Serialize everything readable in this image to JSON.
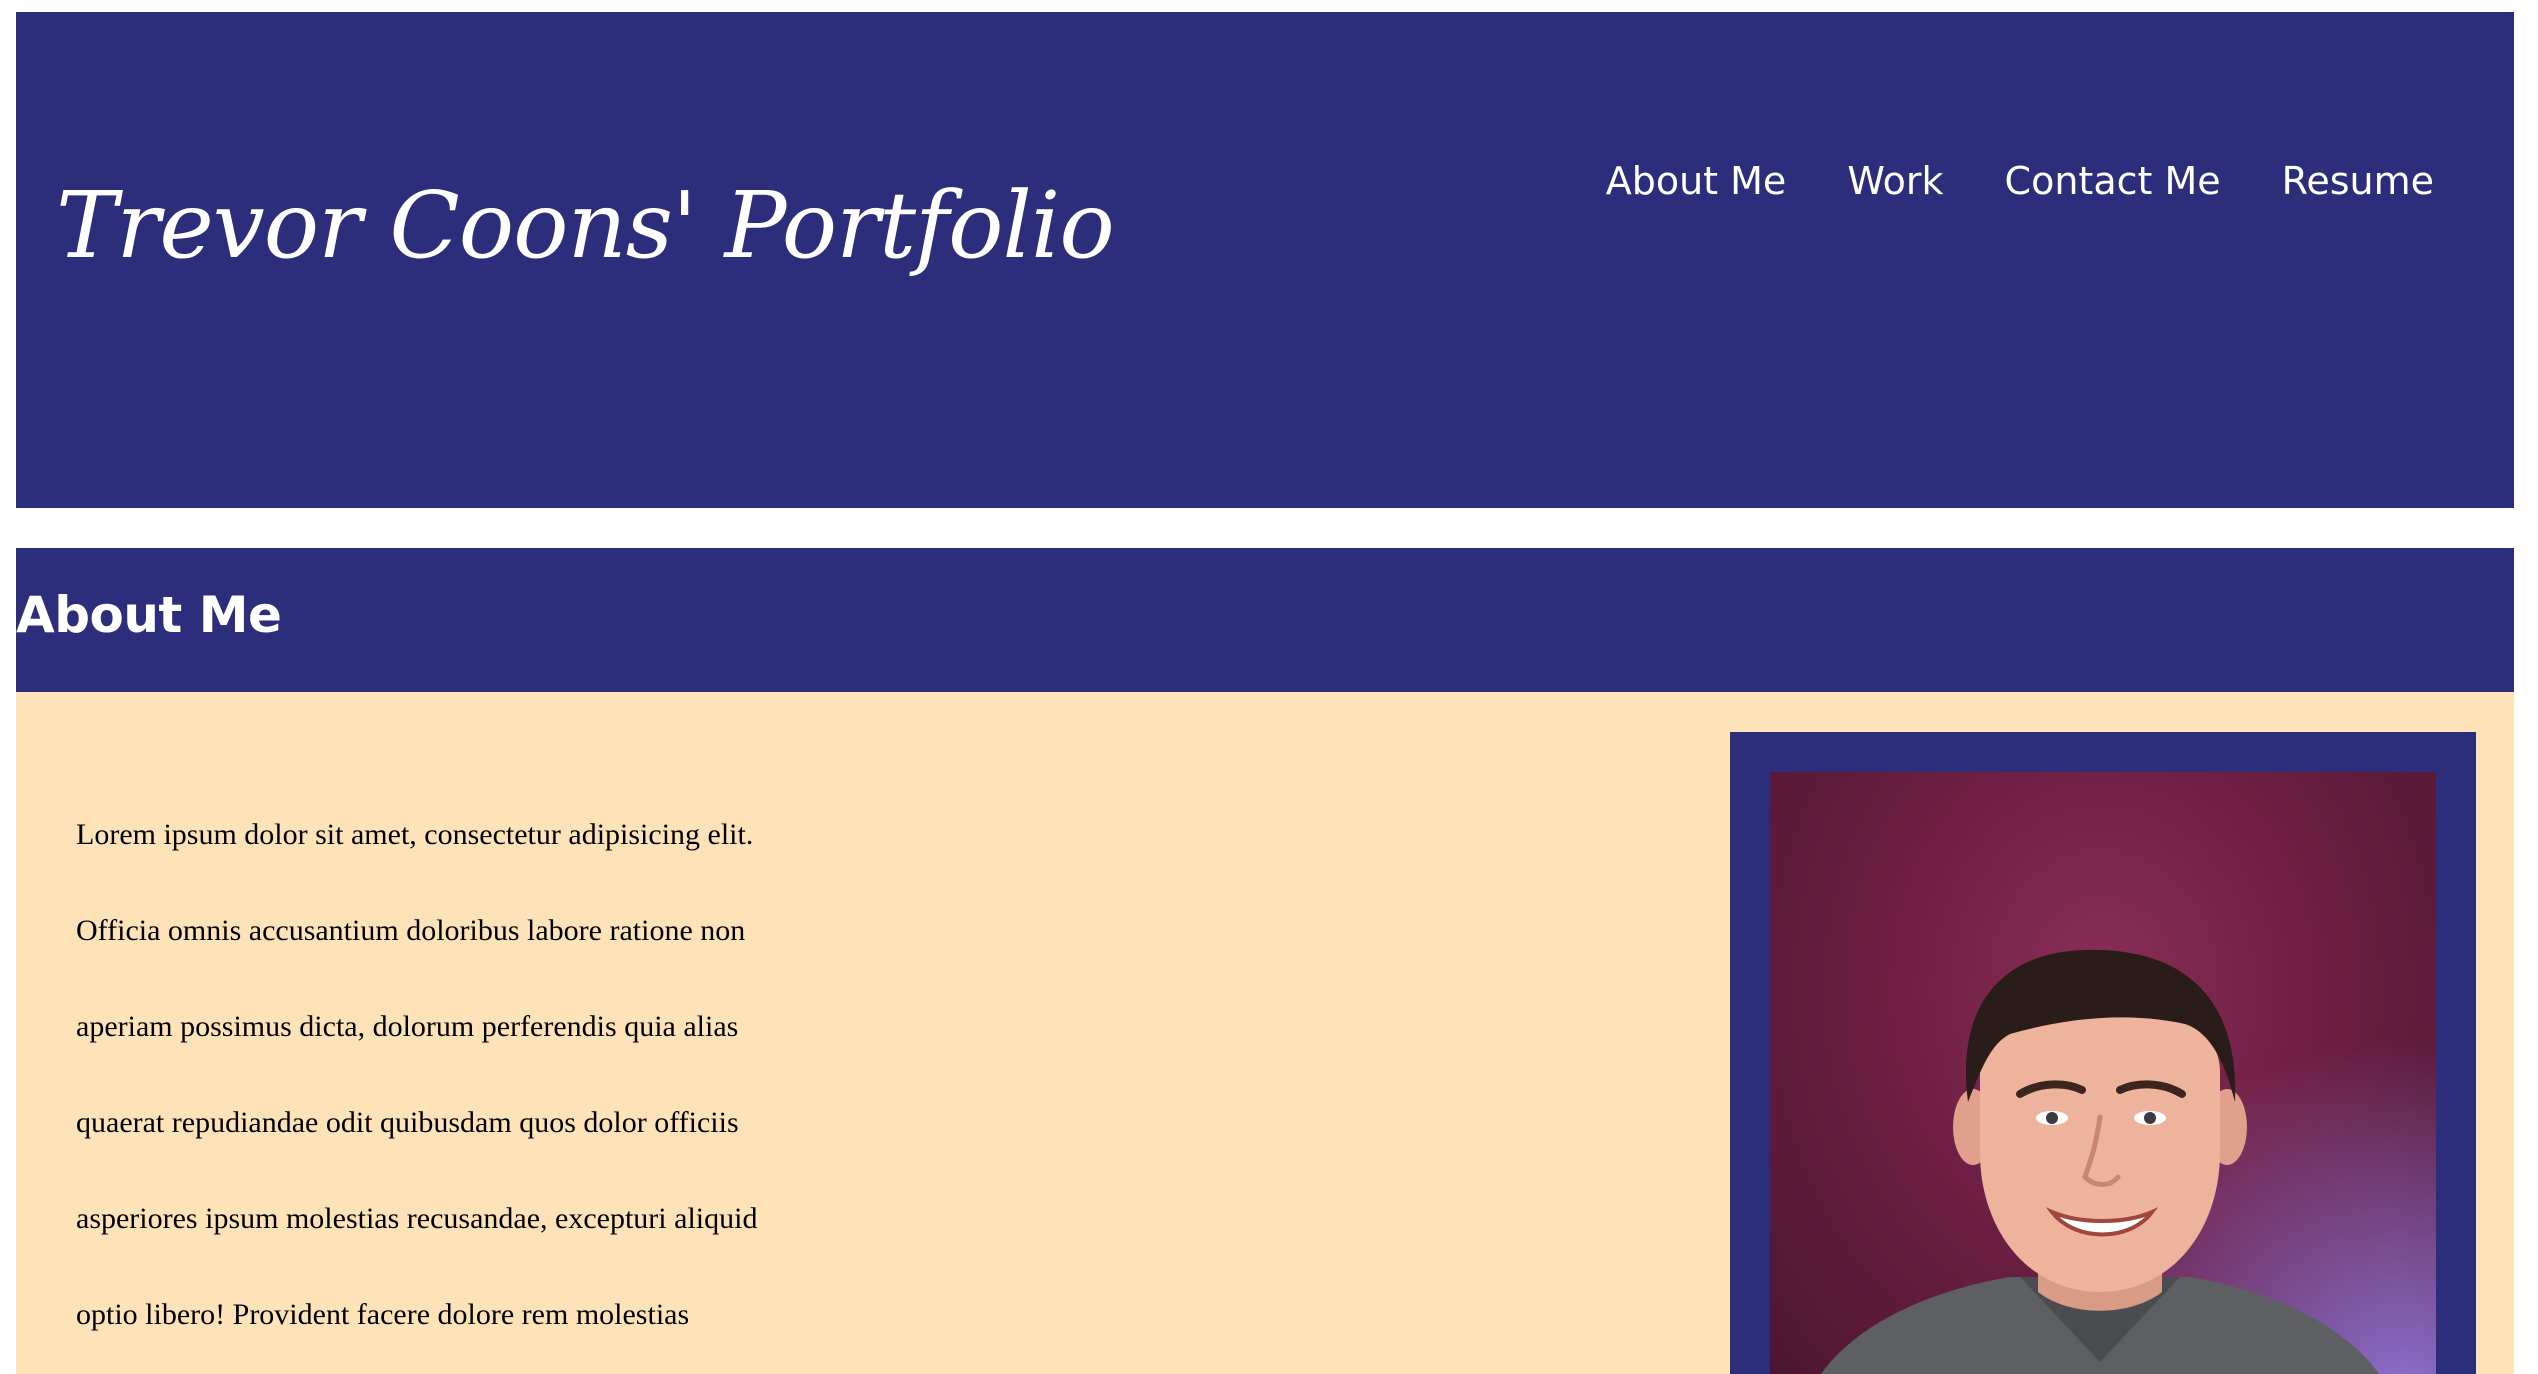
{
  "header": {
    "title": "Trevor Coons' Portfolio",
    "nav": [
      "About Me",
      "Work",
      "Contact Me",
      "Resume"
    ]
  },
  "about": {
    "heading": "About Me",
    "lines": [
      "Lorem ipsum dolor sit amet, consectetur adipisicing elit.",
      "Officia omnis accusantium doloribus labore ratione non",
      "aperiam possimus dicta, dolorum perferendis quia alias",
      "quaerat repudiandae odit quibusdam quos dolor officiis",
      "asperiores ipsum molestias recusandae, excepturi aliquid",
      "optio libero! Provident facere dolore rem molestias"
    ]
  },
  "colors": {
    "brand_navy": "#2c2e7b",
    "content_background": "#fee3b8",
    "text_light": "#ffffff",
    "text_dark": "#000000"
  }
}
